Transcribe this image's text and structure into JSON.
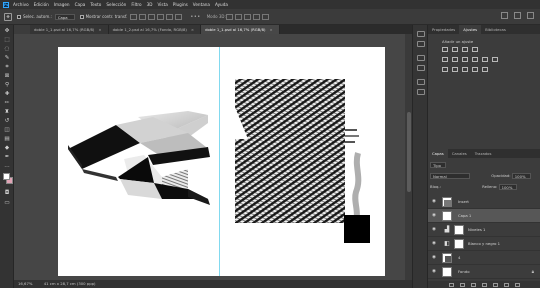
{
  "menubar": {
    "app_icon": "Ps",
    "items": [
      "Archivo",
      "Edición",
      "Imagen",
      "Capa",
      "Texto",
      "Selección",
      "Filtro",
      "3D",
      "Vista",
      "Plugins",
      "Ventana",
      "Ayuda"
    ]
  },
  "options": {
    "tool_icon": "move-icon",
    "auto_select_label": "Selec. autom.:",
    "auto_select_value": "Capa",
    "transform_label": "Mostrar contr. transf.",
    "mode_label": "Modo 3D:"
  },
  "tabs": [
    {
      "label": "doble 1_1.psd al 16,7% (RGB/8)",
      "active": false
    },
    {
      "label": "doble 1_2.psd al 16,7% (Fondo, RGB/8)",
      "active": false
    },
    {
      "label": "doble 1_1.psd al 16,7% (RGB/8)",
      "active": true
    }
  ],
  "tab_close": "×",
  "status": {
    "zoom": "16,67%",
    "doc_size": "41 cm x 28,7 cm (300 ppp)"
  },
  "properties_panel": {
    "tabs": [
      "Propiedades",
      "Ajustes",
      "Bibliotecas"
    ],
    "active_tab": "Ajustes",
    "subtitle": "Añadir un ajuste"
  },
  "layers_panel": {
    "tabs": [
      "Capas",
      "Canales",
      "Trazados"
    ],
    "active_tab": "Capas",
    "search_placeholder": "Tipo",
    "blend_mode": "Normal",
    "opacity_label": "Opacidad:",
    "opacity_value": "100%",
    "lock_label": "Bloq.:",
    "fill_label": "Relleno:",
    "fill_value": "100%",
    "layers": [
      {
        "name": "Insert",
        "visible": true,
        "selected": false,
        "kind": "image",
        "locked": false
      },
      {
        "name": "Capa 1",
        "visible": true,
        "selected": true,
        "kind": "image",
        "locked": false
      },
      {
        "name": "Niveles 1",
        "visible": true,
        "selected": false,
        "kind": "adjustment",
        "locked": false
      },
      {
        "name": "Blanco y negro 1",
        "visible": true,
        "selected": false,
        "kind": "adjustment",
        "locked": false
      },
      {
        "name": "4",
        "visible": true,
        "selected": false,
        "kind": "image",
        "locked": false
      },
      {
        "name": "Fondo",
        "visible": true,
        "selected": false,
        "kind": "background",
        "locked": true
      }
    ]
  },
  "colors": {
    "foreground": "#ffffff",
    "background": "#e2a4b6",
    "guide": "#4cc9e8",
    "ps_blue": "#31a8ff"
  }
}
